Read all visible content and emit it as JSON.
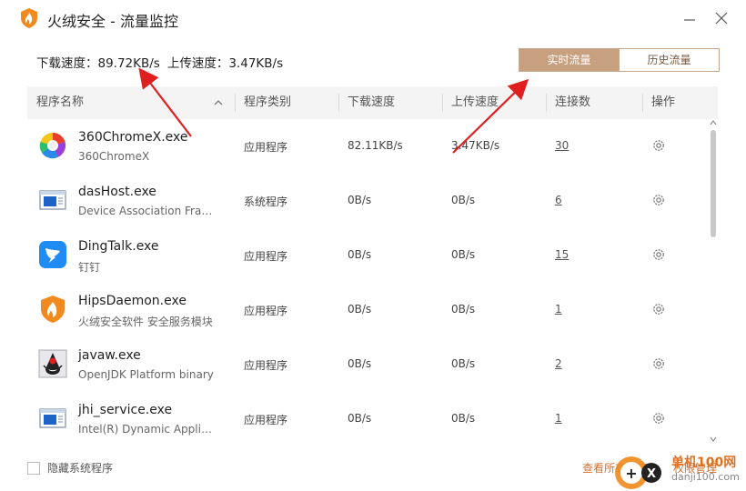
{
  "window": {
    "title": "火绒安全 - 流量监控"
  },
  "speed": {
    "download_label": "下载速度：",
    "download_value": "89.72KB/s",
    "upload_label": "上传速度：",
    "upload_value": "3.47KB/s"
  },
  "tabs": [
    {
      "label": "实时流量",
      "active": true
    },
    {
      "label": "历史流量",
      "active": false
    }
  ],
  "table": {
    "columns": [
      "程序名称",
      "程序类别",
      "下载速度",
      "上传速度",
      "连接数",
      "操作"
    ],
    "rows": [
      {
        "name": "360ChromeX.exe",
        "desc": "360ChromeX",
        "category": "应用程序",
        "down": "82.11KB/s",
        "up": "3.47KB/s",
        "connections": "30",
        "icon": "chrome-like-icon"
      },
      {
        "name": "dasHost.exe",
        "desc": "Device Association Framework Provider Host",
        "category": "系统程序",
        "down": "0B/s",
        "up": "0B/s",
        "connections": "6",
        "icon": "window-app-icon"
      },
      {
        "name": "DingTalk.exe",
        "desc": "钉钉",
        "category": "应用程序",
        "down": "0B/s",
        "up": "0B/s",
        "connections": "15",
        "icon": "dingtalk-icon"
      },
      {
        "name": "HipsDaemon.exe",
        "desc": "火绒安全软件 安全服务模块",
        "category": "应用程序",
        "down": "0B/s",
        "up": "0B/s",
        "connections": "1",
        "icon": "huorong-shield-icon"
      },
      {
        "name": "javaw.exe",
        "desc": "OpenJDK Platform binary",
        "category": "应用程序",
        "down": "0B/s",
        "up": "0B/s",
        "connections": "2",
        "icon": "java-duke-icon"
      },
      {
        "name": "jhi_service.exe",
        "desc": "Intel(R) Dynamic Application Loader Host Interface",
        "category": "应用程序",
        "down": "0B/s",
        "up": "0B/s",
        "connections": "1",
        "icon": "window-app-icon"
      }
    ]
  },
  "footer": {
    "hide_system_label": "隐藏系统程序",
    "link_left": "查看所有程序",
    "link_right": "权限管理",
    "watermark_text": "单机100网",
    "watermark_url": "danji100.com"
  },
  "colors": {
    "accent": "#c7a080",
    "link": "#d07030",
    "arrow": "#e02020"
  }
}
